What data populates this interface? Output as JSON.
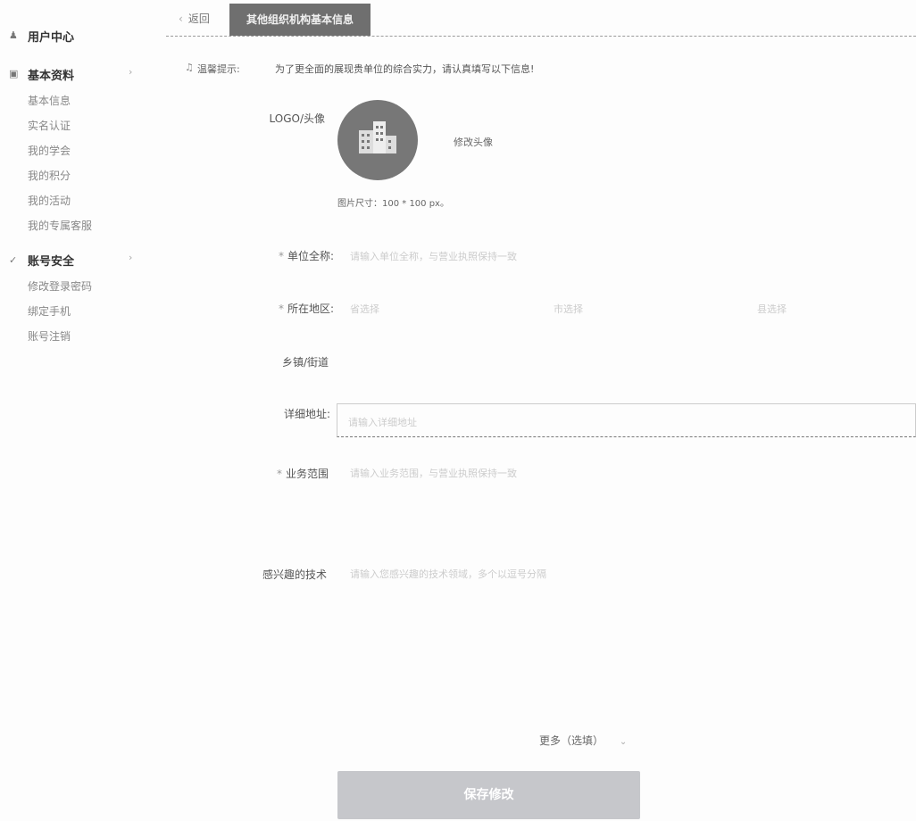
{
  "sidebar": {
    "user_center": "用户中心",
    "basic_info": {
      "title": "基本资料",
      "items": [
        "基本信息",
        "实名认证",
        "我的学会",
        "我的积分",
        "我的活动",
        "我的专属客服"
      ]
    },
    "account_security": {
      "title": "账号安全",
      "items": [
        "修改登录密码",
        "绑定手机",
        "账号注销"
      ]
    }
  },
  "tabs": {
    "back": "返回",
    "active": "其他组织机构基本信息"
  },
  "tip": {
    "label": "温馨提示:",
    "text": "为了更全面的展现贵单位的综合实力，请认真填写以下信息!"
  },
  "logo": {
    "label": "LOGO/头像",
    "change": "修改头像",
    "size_hint": "图片尺寸：100 * 100 px。"
  },
  "form": {
    "org_name": {
      "label": "单位全称:",
      "placeholder": "请输入单位全称，与营业执照保持一致"
    },
    "region": {
      "label": "所在地区:",
      "province": "省选择",
      "city": "市选择",
      "district": "县选择"
    },
    "town": {
      "label": "乡镇/街道"
    },
    "address": {
      "label": "详细地址:",
      "placeholder": "请输入详细地址"
    },
    "business": {
      "label": "业务范围",
      "placeholder": "请输入业务范围，与营业执照保持一致"
    },
    "tech": {
      "label": "感兴趣的技术",
      "placeholder": "请输入您感兴趣的技术领域，多个以逗号分隔"
    }
  },
  "more": "更多（选填）",
  "save_button": "保存修改"
}
